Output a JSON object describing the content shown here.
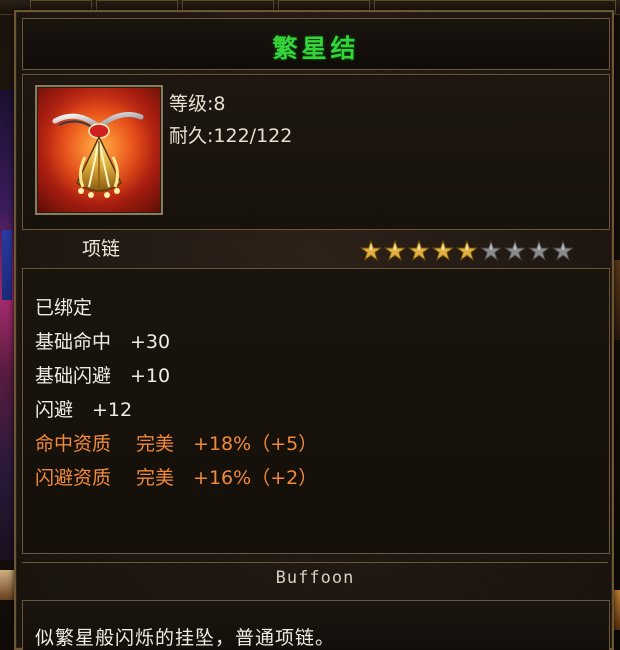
{
  "item": {
    "name": "繁星结",
    "level": "等级:8",
    "durability": "耐久:122/122",
    "type": "项链",
    "stars_filled": 5,
    "stars_total": 9,
    "icon": "necklace-icon"
  },
  "attributes": {
    "bound": "已绑定",
    "base_hit": "基础命中　+30",
    "base_dodge": "基础闪避　+10",
    "dodge": "闪避　+12",
    "hit_quality": "命中资质　 完美　+18%（+5）",
    "dodge_quality": "闪避资质　 完美　+16%（+2）"
  },
  "author": "Buffoon",
  "description": "似繁星般闪烁的挂坠，普通项链。",
  "colors": {
    "title": "#34d43a",
    "text": "#f0ece4",
    "quality": "#f08a3a",
    "border": "#6a563a",
    "star_filled": "#e0b040",
    "star_empty": "#8a8a8a"
  }
}
